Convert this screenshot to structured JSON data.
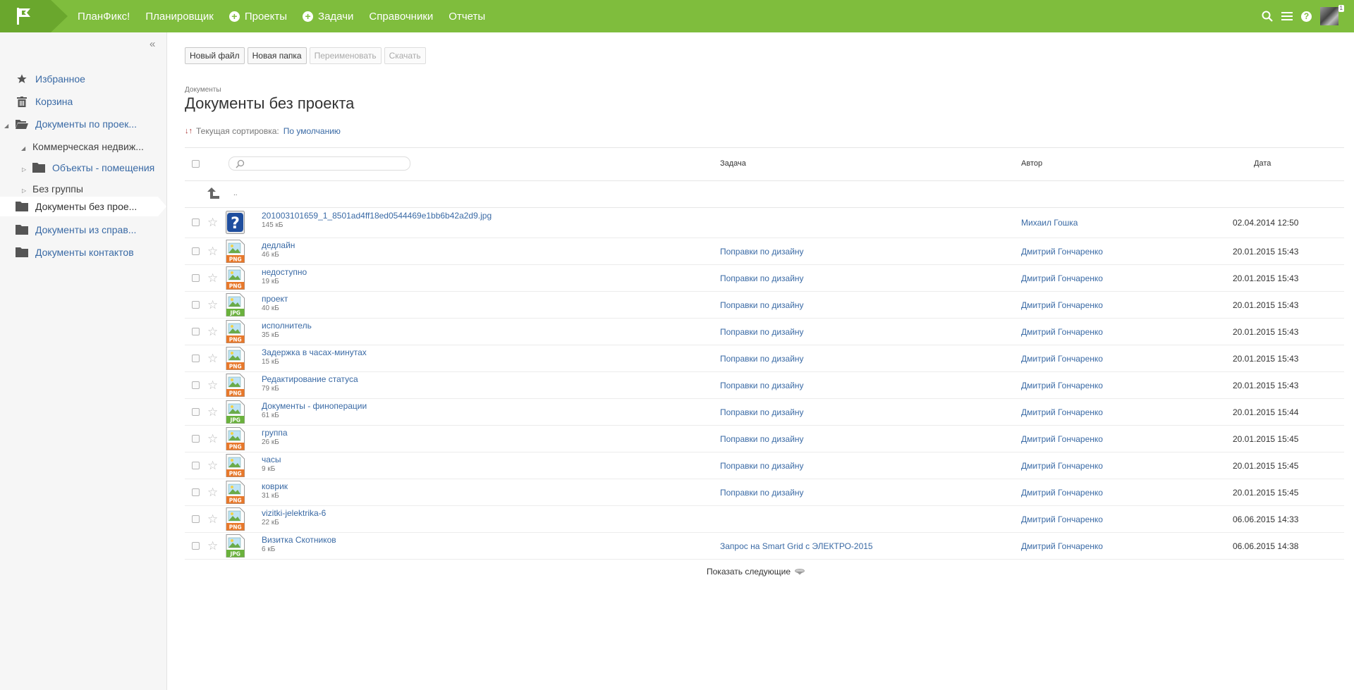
{
  "topbar": {
    "brand": "ПланФикс!",
    "nav": [
      {
        "label": "Планировщик",
        "icon": ""
      },
      {
        "label": "Проекты",
        "icon": "plus-circle-icon"
      },
      {
        "label": "Задачи",
        "icon": "plus-circle-icon"
      },
      {
        "label": "Справочники",
        "icon": ""
      },
      {
        "label": "Отчеты",
        "icon": ""
      }
    ],
    "icons": [
      "search-icon",
      "menu-icon",
      "help-icon",
      "avatar"
    ],
    "notification_count": "1",
    "colors": {
      "bar": "#7fbd3d",
      "logo_block": "#6aa72d"
    }
  },
  "sidebar": {
    "items": [
      {
        "label": "Избранное",
        "icon": "star-icon"
      },
      {
        "label": "Корзина",
        "icon": "trash-icon"
      },
      {
        "label": "Документы по проек...",
        "icon": "folder-open-icon"
      },
      {
        "label": "Коммерческая недвиж...",
        "icon": ""
      },
      {
        "label": "Объекты - помещения",
        "icon": "folder-icon"
      },
      {
        "label": "Без группы",
        "icon": ""
      },
      {
        "label": "Документы без прое...",
        "icon": "folder-icon"
      },
      {
        "label": "Документы из справ...",
        "icon": "folder-icon"
      },
      {
        "label": "Документы контактов",
        "icon": "folder-icon"
      }
    ],
    "active_index": 6
  },
  "toolbar": {
    "new_file": "Новый файл",
    "new_folder": "Новая папка",
    "rename": "Переименовать",
    "download": "Скачать"
  },
  "breadcrumb": "Документы",
  "page_title": "Документы без проекта",
  "sort": {
    "label": "Текущая сортировка:",
    "value": "По умолчанию"
  },
  "table": {
    "columns": {
      "task": "Задача",
      "author": "Автор",
      "date": "Дата"
    },
    "up_label": "..",
    "files": [
      {
        "name": "201003101659_1_8501ad4ff18ed0544469e1bb6b42a2d9.jpg",
        "size": "145 кБ",
        "type": "unknown",
        "task": "",
        "author": "Михаил Гошка",
        "date": "02.04.2014 12:50"
      },
      {
        "name": "дедлайн",
        "size": "46 кБ",
        "type": "PNG",
        "task": "Поправки по дизайну",
        "author": "Дмитрий Гончаренко",
        "date": "20.01.2015 15:43"
      },
      {
        "name": "недоступно",
        "size": "19 кБ",
        "type": "PNG",
        "task": "Поправки по дизайну",
        "author": "Дмитрий Гончаренко",
        "date": "20.01.2015 15:43"
      },
      {
        "name": "проект",
        "size": "40 кБ",
        "type": "JPG",
        "task": "Поправки по дизайну",
        "author": "Дмитрий Гончаренко",
        "date": "20.01.2015 15:43"
      },
      {
        "name": "исполнитель",
        "size": "35 кБ",
        "type": "PNG",
        "task": "Поправки по дизайну",
        "author": "Дмитрий Гончаренко",
        "date": "20.01.2015 15:43"
      },
      {
        "name": "Задержка в часах-минутах",
        "size": "15 кБ",
        "type": "PNG",
        "task": "Поправки по дизайну",
        "author": "Дмитрий Гончаренко",
        "date": "20.01.2015 15:43"
      },
      {
        "name": "Редактирование статуса",
        "size": "79 кБ",
        "type": "PNG",
        "task": "Поправки по дизайну",
        "author": "Дмитрий Гончаренко",
        "date": "20.01.2015 15:43"
      },
      {
        "name": "Документы - финоперации",
        "size": "61 кБ",
        "type": "JPG",
        "task": "Поправки по дизайну",
        "author": "Дмитрий Гончаренко",
        "date": "20.01.2015 15:44"
      },
      {
        "name": "группа",
        "size": "26 кБ",
        "type": "PNG",
        "task": "Поправки по дизайну",
        "author": "Дмитрий Гончаренко",
        "date": "20.01.2015 15:45"
      },
      {
        "name": "часы",
        "size": "9 кБ",
        "type": "PNG",
        "task": "Поправки по дизайну",
        "author": "Дмитрий Гончаренко",
        "date": "20.01.2015 15:45"
      },
      {
        "name": "коврик",
        "size": "31 кБ",
        "type": "PNG",
        "task": "Поправки по дизайну",
        "author": "Дмитрий Гончаренко",
        "date": "20.01.2015 15:45"
      },
      {
        "name": "vizitki-jelektrika-6",
        "size": "22 кБ",
        "type": "PNG",
        "task": "",
        "author": "Дмитрий Гончаренко",
        "date": "06.06.2015 14:33"
      },
      {
        "name": "Визитка Скотников",
        "size": "6 кБ",
        "type": "JPG",
        "task": "Запрос на Smart Grid с ЭЛЕКТРО-2015",
        "author": "Дмитрий Гончаренко",
        "date": "06.06.2015 14:38"
      }
    ]
  },
  "show_more": "Показать следующие",
  "colors": {
    "link": "#3a6aa5",
    "png_badge": "#e8782a",
    "jpg_badge": "#6ab23c"
  }
}
